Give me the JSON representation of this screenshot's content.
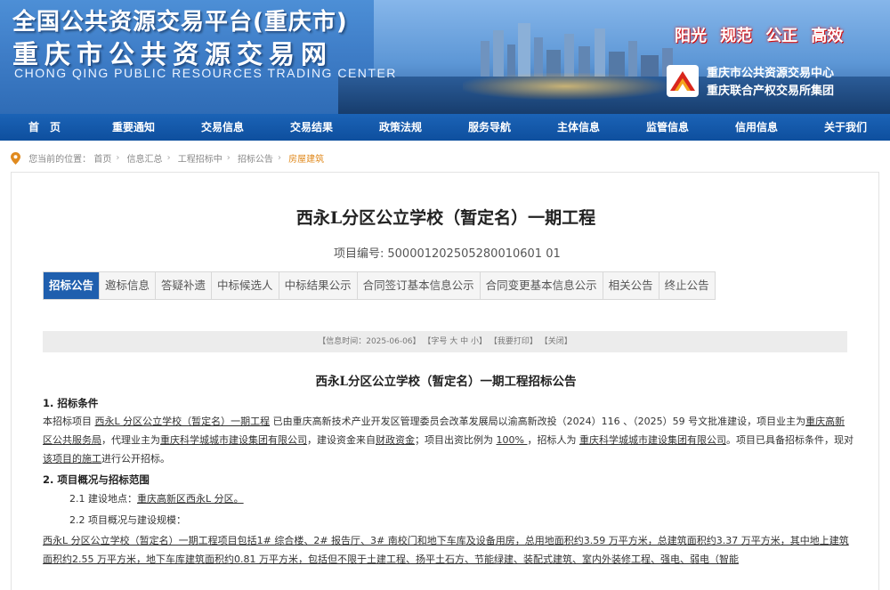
{
  "banner": {
    "title_line1": "全国公共资源交易平台(重庆市)",
    "title_line2": "重庆市公共资源交易网",
    "title_en": "CHONG QING PUBLIC RESOURCES TRADING CENTER",
    "slogans": [
      "阳光",
      "规范",
      "公正",
      "高效"
    ],
    "org_line1": "重庆市公共资源交易中心",
    "org_line2": "重庆联合产权交易所集团",
    "slogan_color": "#e52020"
  },
  "nav": {
    "items": [
      "首　页",
      "重要通知",
      "交易信息",
      "交易结果",
      "政策法规",
      "服务导航",
      "主体信息",
      "监管信息",
      "信用信息",
      "关于我们"
    ]
  },
  "breadcrumb": {
    "prefix": "您当前的位置：",
    "items": [
      "首页",
      "信息汇总",
      "工程招标中",
      "招标公告"
    ],
    "current": "房屋建筑"
  },
  "project": {
    "title": "西永L分区公立学校（暂定名）一期工程",
    "code_label": "项目编号:",
    "code": "500001202505280010601 01"
  },
  "tabs": [
    "招标公告",
    "邀标信息",
    "答疑补遗",
    "中标候选人",
    "中标结果公示",
    "合同签订基本信息公示",
    "合同变更基本信息公示",
    "相关公告",
    "终止公告"
  ],
  "info_bar": {
    "time": "【信息时间：2025-06-06】",
    "font": "【字号 大 中 小】",
    "print": "【我要打印】",
    "close": "【关闭】"
  },
  "announcement": {
    "title": "西永L分区公立学校（暂定名）一期工程招标公告",
    "s1_heading": "1. 招标条件",
    "s1_p1": "本招标项目 ",
    "s1_name": "西永L 分区公立学校（暂定名）一期工程",
    "s1_p2": " 已由重庆高新技术产业开发区管理委员会改革发展局以渝高新改投（2024）116 、（2025）59 号文批准建设，项目业主为",
    "s1_owner": "重庆高新区公共服务局",
    "s1_p3": "，代理业主为",
    "s1_agent": "重庆科学城城市建设集团有限公司",
    "s1_p4": "，建设资金来自",
    "s1_fund": "财政资金",
    "s1_p5": "；项目出资比例为 ",
    "s1_ratio": "100% ",
    "s1_p6": "，招标人为 ",
    "s1_tenderer": "重庆科学城城市建设集团有限公司",
    "s1_p7": "。项目已具备招标条件，现对",
    "s1_scope": "该项目的施工",
    "s1_p8": "进行公开招标。",
    "s2_heading": "2. 项目概况与招标范围",
    "s2_1_label": "2.1  建设地点：",
    "s2_1_value": "重庆高新区西永L 分区。",
    "s2_2_label": "2.2  项目概况与建设规模：",
    "s2_2_text": "西永L 分区公立学校（暂定名）一期工程项目包括1# 综合楼、2# 报告厅、3# 南校门和地下车库及设备用房，总用地面积约3.59 万平方米，总建筑面积约3.37 万平方米，其中地上建筑面积约2.55 万平方米，地下车库建筑面积约0.81 万平方米，包括但不限于土建工程、扬平土石方、节能绿建、装配式建筑、室内外装修工程、强电、弱电（智能"
  }
}
